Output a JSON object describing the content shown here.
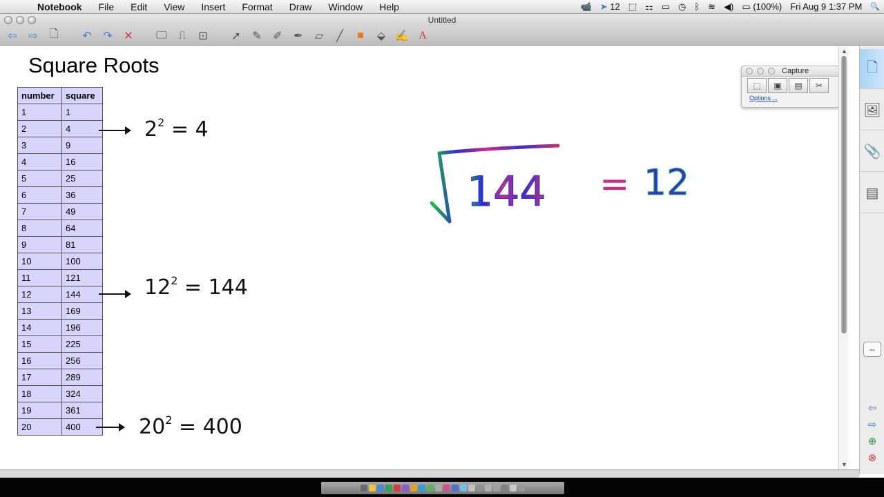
{
  "menubar": {
    "apple": "",
    "app": "Notebook",
    "menus": [
      "File",
      "Edit",
      "View",
      "Insert",
      "Format",
      "Draw",
      "Window",
      "Help"
    ],
    "status": {
      "camera": "📹",
      "cursor_count": "12",
      "battery": "(100%)",
      "datetime": "Fri Aug 9  1:37 PM",
      "search": "🔍"
    }
  },
  "window": {
    "title": "Untitled"
  },
  "page": {
    "title": "Square Roots",
    "table": {
      "headers": [
        "number",
        "square"
      ],
      "rows": [
        [
          "1",
          "1"
        ],
        [
          "2",
          "4"
        ],
        [
          "3",
          "9"
        ],
        [
          "4",
          "16"
        ],
        [
          "5",
          "25"
        ],
        [
          "6",
          "36"
        ],
        [
          "7",
          "49"
        ],
        [
          "8",
          "64"
        ],
        [
          "9",
          "81"
        ],
        [
          "10",
          "100"
        ],
        [
          "11",
          "121"
        ],
        [
          "12",
          "144"
        ],
        [
          "13",
          "169"
        ],
        [
          "14",
          "196"
        ],
        [
          "15",
          "225"
        ],
        [
          "16",
          "256"
        ],
        [
          "17",
          "289"
        ],
        [
          "18",
          "324"
        ],
        [
          "19",
          "361"
        ],
        [
          "20",
          "400"
        ]
      ]
    },
    "notes": [
      {
        "base": "2",
        "exp": "2",
        "result": "= 4"
      },
      {
        "base": "12",
        "exp": "2",
        "result": "= 144"
      },
      {
        "base": "20",
        "exp": "2",
        "result": "= 400"
      }
    ],
    "radical": {
      "radicand": "144",
      "equals": "=",
      "answer": "12"
    }
  },
  "capture": {
    "title": "Capture",
    "options": "Options ..."
  },
  "colors": {
    "table_bg": "#d9d4fb",
    "accent_blue": "#3a7fd0",
    "side_tab_active": "#a9d3f5"
  }
}
